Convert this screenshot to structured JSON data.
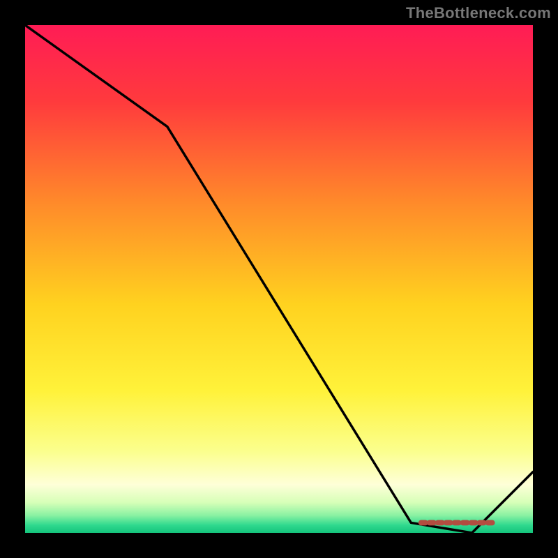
{
  "watermark": "TheBottleneck.com",
  "chart_data": {
    "type": "line",
    "title": "",
    "xlabel": "",
    "ylabel": "",
    "xlim": [
      0,
      100
    ],
    "ylim": [
      0,
      100
    ],
    "grid": false,
    "legend": false,
    "series": [
      {
        "name": "curve",
        "color": "#000000",
        "x": [
          0,
          28,
          76,
          88,
          100
        ],
        "values": [
          100,
          80,
          2,
          0,
          12
        ]
      }
    ],
    "optimal_marker": {
      "x_start": 78,
      "x_end": 92,
      "y": 2,
      "color": "#b34d40"
    },
    "background": {
      "type": "vertical-gradient",
      "stops": [
        {
          "offset": 0,
          "color": "#ff1c55"
        },
        {
          "offset": 0.15,
          "color": "#ff3a3d"
        },
        {
          "offset": 0.35,
          "color": "#ff8a2a"
        },
        {
          "offset": 0.55,
          "color": "#ffd21f"
        },
        {
          "offset": 0.72,
          "color": "#fff23a"
        },
        {
          "offset": 0.84,
          "color": "#fbff8e"
        },
        {
          "offset": 0.905,
          "color": "#feffd8"
        },
        {
          "offset": 0.94,
          "color": "#d7ffb8"
        },
        {
          "offset": 0.965,
          "color": "#8cf2a3"
        },
        {
          "offset": 0.985,
          "color": "#2fd98e"
        },
        {
          "offset": 1.0,
          "color": "#14c47c"
        }
      ]
    }
  }
}
